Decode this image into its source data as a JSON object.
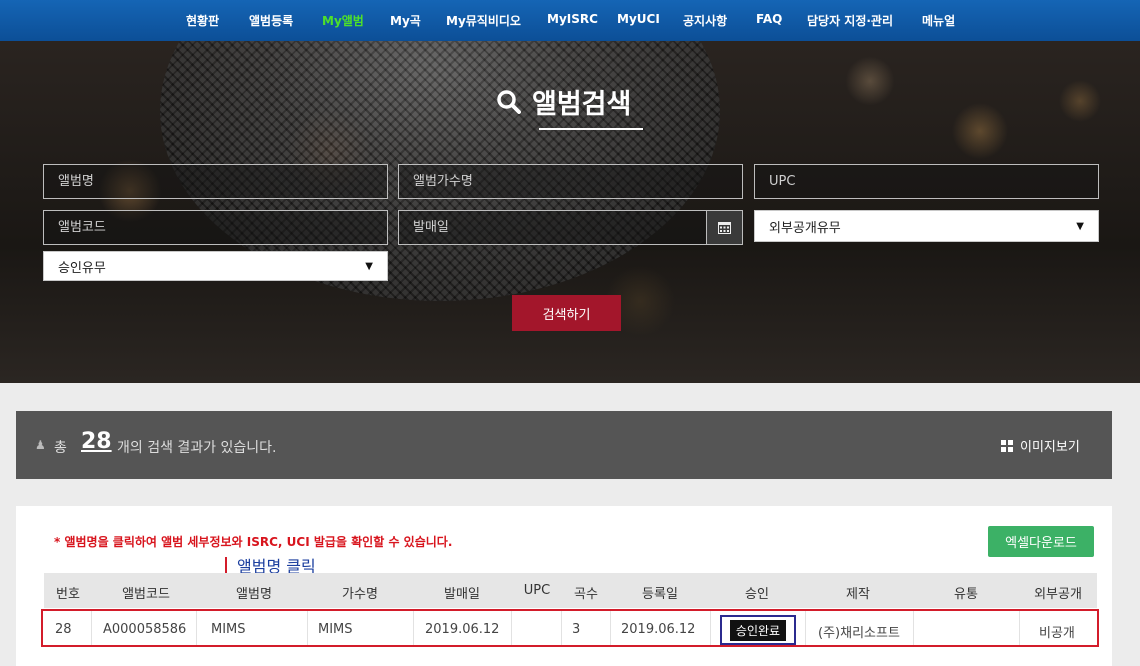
{
  "nav": {
    "items": [
      "현황판",
      "앨범등록",
      "My앨범",
      "My곡",
      "My뮤직비디오",
      "MyISRC",
      "MyUCI",
      "공지사항",
      "FAQ",
      "담당자 지정·관리",
      "메뉴얼"
    ],
    "active": "My앨범"
  },
  "search": {
    "title": "앨범검색",
    "album_name_placeholder": "앨범명",
    "artist_placeholder": "앨범가수명",
    "upc_placeholder": "UPC",
    "album_code_placeholder": "앨범코드",
    "release_date_placeholder": "발매일",
    "public_select": "외부공개유무",
    "approval_select": "승인유무",
    "button": "검색하기"
  },
  "results": {
    "prefix": "총",
    "count": "28",
    "suffix": "개의 검색 결과가 있습니다.",
    "image_view": "이미지보기"
  },
  "table": {
    "notice": "* 앨범명을 클릭하여 앨범 세부정보와 ISRC, UCI 발급을 확인할 수 있습니다.",
    "excel_button": "엑셀다운로드",
    "annotation": "앨범명 클릭",
    "headers": [
      "번호",
      "앨범코드",
      "앨범명",
      "가수명",
      "발매일",
      "UPC",
      "곡수",
      "등록일",
      "승인",
      "제작",
      "유통",
      "외부공개"
    ],
    "rows": [
      [
        "28",
        "A000058586",
        "MIMS",
        "MIMS",
        "2019.06.12",
        "",
        "3",
        "2019.06.12",
        "승인완료",
        "(주)채리소프트",
        "",
        "비공개"
      ]
    ]
  },
  "colors": {
    "nav_bg": "#1565b5",
    "active_nav": "#4ee02a",
    "search_button": "#a3162b",
    "excel_button": "#3cb166",
    "highlight": "#d31c2a"
  }
}
